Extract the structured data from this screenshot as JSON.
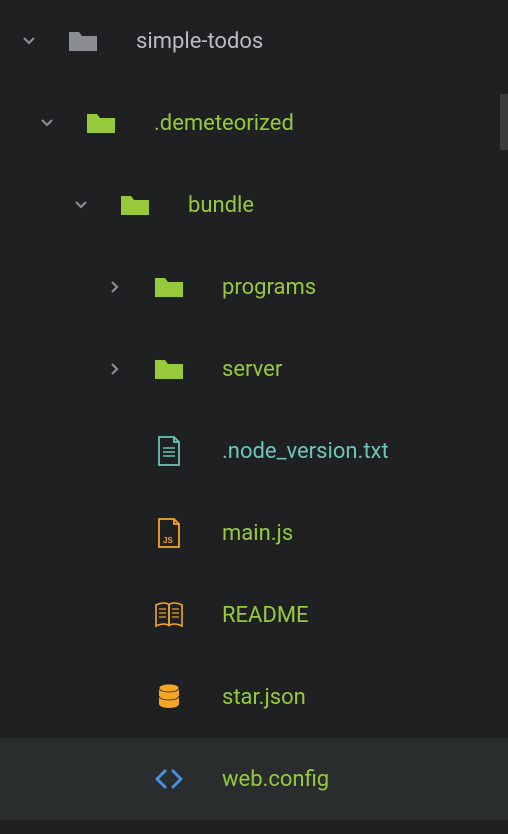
{
  "tree": {
    "root": {
      "label": "simple-todos",
      "expanded": true
    },
    "demeteorized": {
      "label": ".demeteorized",
      "expanded": true
    },
    "bundle": {
      "label": "bundle",
      "expanded": true
    },
    "programs": {
      "label": "programs",
      "expanded": false
    },
    "server": {
      "label": "server",
      "expanded": false
    },
    "node_version": {
      "label": ".node_version.txt"
    },
    "main_js": {
      "label": "main.js"
    },
    "readme": {
      "label": "README"
    },
    "star_json": {
      "label": "star.json"
    },
    "web_config": {
      "label": "web.config"
    }
  },
  "colors": {
    "folder_gray": "#8a8e92",
    "folder_green": "#97c93d",
    "file_teal": "#6ec4b8",
    "file_orange": "#f5a623",
    "file_blue": "#4a90e2",
    "chevron": "#8a8e92"
  }
}
